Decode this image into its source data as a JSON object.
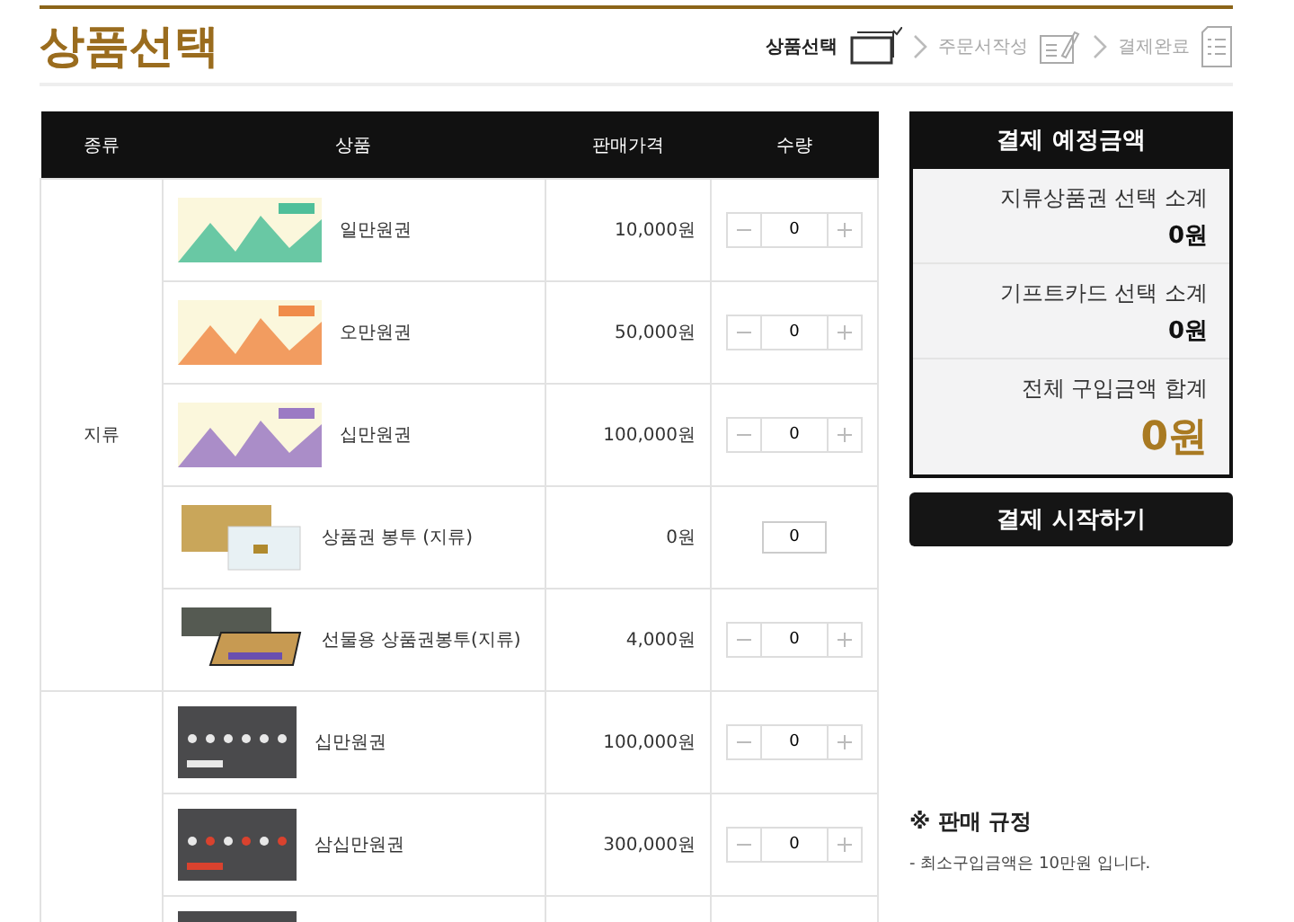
{
  "page_title": "상품선택",
  "steps": [
    {
      "label": "상품선택",
      "selected": true,
      "kind": "cards"
    },
    {
      "label": "주문서작성",
      "selected": false,
      "kind": "form"
    },
    {
      "label": "결제완료",
      "selected": false,
      "kind": "checklist"
    }
  ],
  "table": {
    "columns": [
      "종류",
      "상품",
      "판매가격",
      "수량"
    ],
    "groups": [
      {
        "type": "지류",
        "rows": [
          {
            "image": {
              "kind": "voucher",
              "color": "#4fbf9a"
            },
            "name": "일만원권",
            "price": "10,000원",
            "qty": {
              "kind": "stepper",
              "value": "0"
            }
          },
          {
            "image": {
              "kind": "voucher",
              "color": "#f08c4a"
            },
            "name": "오만원권",
            "price": "50,000원",
            "qty": {
              "kind": "stepper",
              "value": "0"
            }
          },
          {
            "image": {
              "kind": "voucher",
              "color": "#9b7ac4"
            },
            "name": "십만원권",
            "price": "100,000원",
            "qty": {
              "kind": "stepper",
              "value": "0"
            }
          },
          {
            "image": {
              "kind": "envelope"
            },
            "name": "상품권 봉투 (지류)",
            "price": "0원",
            "qty": {
              "kind": "fixed",
              "value": "0"
            }
          },
          {
            "image": {
              "kind": "giftbox"
            },
            "name": "선물용 상품권봉투(지류)",
            "price": "4,000원",
            "qty": {
              "kind": "stepper",
              "value": "0"
            }
          }
        ]
      },
      {
        "rows": [
          {
            "image": {
              "kind": "card",
              "color": "#e8e8e8"
            },
            "name": "십만원권",
            "price": "100,000원",
            "qty": {
              "kind": "stepper",
              "value": "0"
            }
          },
          {
            "image": {
              "kind": "card",
              "color": "#d9422e"
            },
            "name": "삼십만원권",
            "price": "300,000원",
            "qty": {
              "kind": "stepper",
              "value": "0"
            }
          },
          {
            "image": {
              "kind": "card"
            }
          }
        ]
      }
    ]
  },
  "summary": {
    "title": "결제 예정금액",
    "lines": [
      {
        "label": "지류상품권 선택 소계",
        "amount": "0원",
        "kind": "sub"
      },
      {
        "label": "기프트카드 선택 소계",
        "amount": "0원",
        "kind": "sub"
      },
      {
        "label": "전체 구입금액 합계",
        "amount": "0원",
        "kind": "total"
      }
    ],
    "button": "결제 시작하기"
  },
  "rules": {
    "title": "※ 판매 규정",
    "items": [
      "- 최소구입금액은 10만원 입니다."
    ]
  }
}
